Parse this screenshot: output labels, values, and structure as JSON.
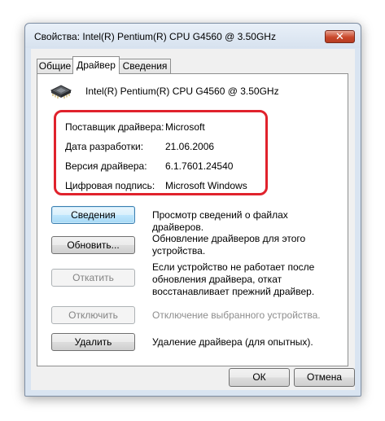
{
  "window": {
    "title": "Свойства: Intel(R) Pentium(R) CPU G4560 @ 3.50GHz",
    "close_symbol": "✕"
  },
  "tabs": [
    {
      "label": "Общие"
    },
    {
      "label": "Драйвер",
      "active": true
    },
    {
      "label": "Сведения"
    }
  ],
  "device": {
    "icon": "cpu-chip-icon",
    "name": "Intel(R) Pentium(R) CPU G4560 @ 3.50GHz"
  },
  "driver_info": [
    {
      "label": "Поставщик драйвера:",
      "value": "Microsoft"
    },
    {
      "label": "Дата разработки:",
      "value": "21.06.2006"
    },
    {
      "label": "Версия драйвера:",
      "value": "6.1.7601.24540"
    },
    {
      "label": "Цифровая подпись:",
      "value": "Microsoft Windows"
    }
  ],
  "actions": [
    {
      "button": "Сведения",
      "description": "Просмотр сведений о файлах драйверов.",
      "enabled": true
    },
    {
      "button": "Обновить...",
      "description": "Обновление драйверов для этого устройства.",
      "enabled": true
    },
    {
      "button": "Откатить",
      "description": "Если устройство не работает после обновления драйвера, откат восстанавливает прежний драйвер.",
      "enabled": false
    },
    {
      "button": "Отключить",
      "description": "Отключение выбранного устройства.",
      "enabled": false
    },
    {
      "button": "Удалить",
      "description": "Удаление драйвера (для опытных).",
      "enabled": true
    }
  ],
  "footer": {
    "ok_label": "ОК",
    "cancel_label": "Отмена"
  },
  "colors": {
    "highlight": "#e0222c",
    "focus": "#3c7fb1"
  }
}
